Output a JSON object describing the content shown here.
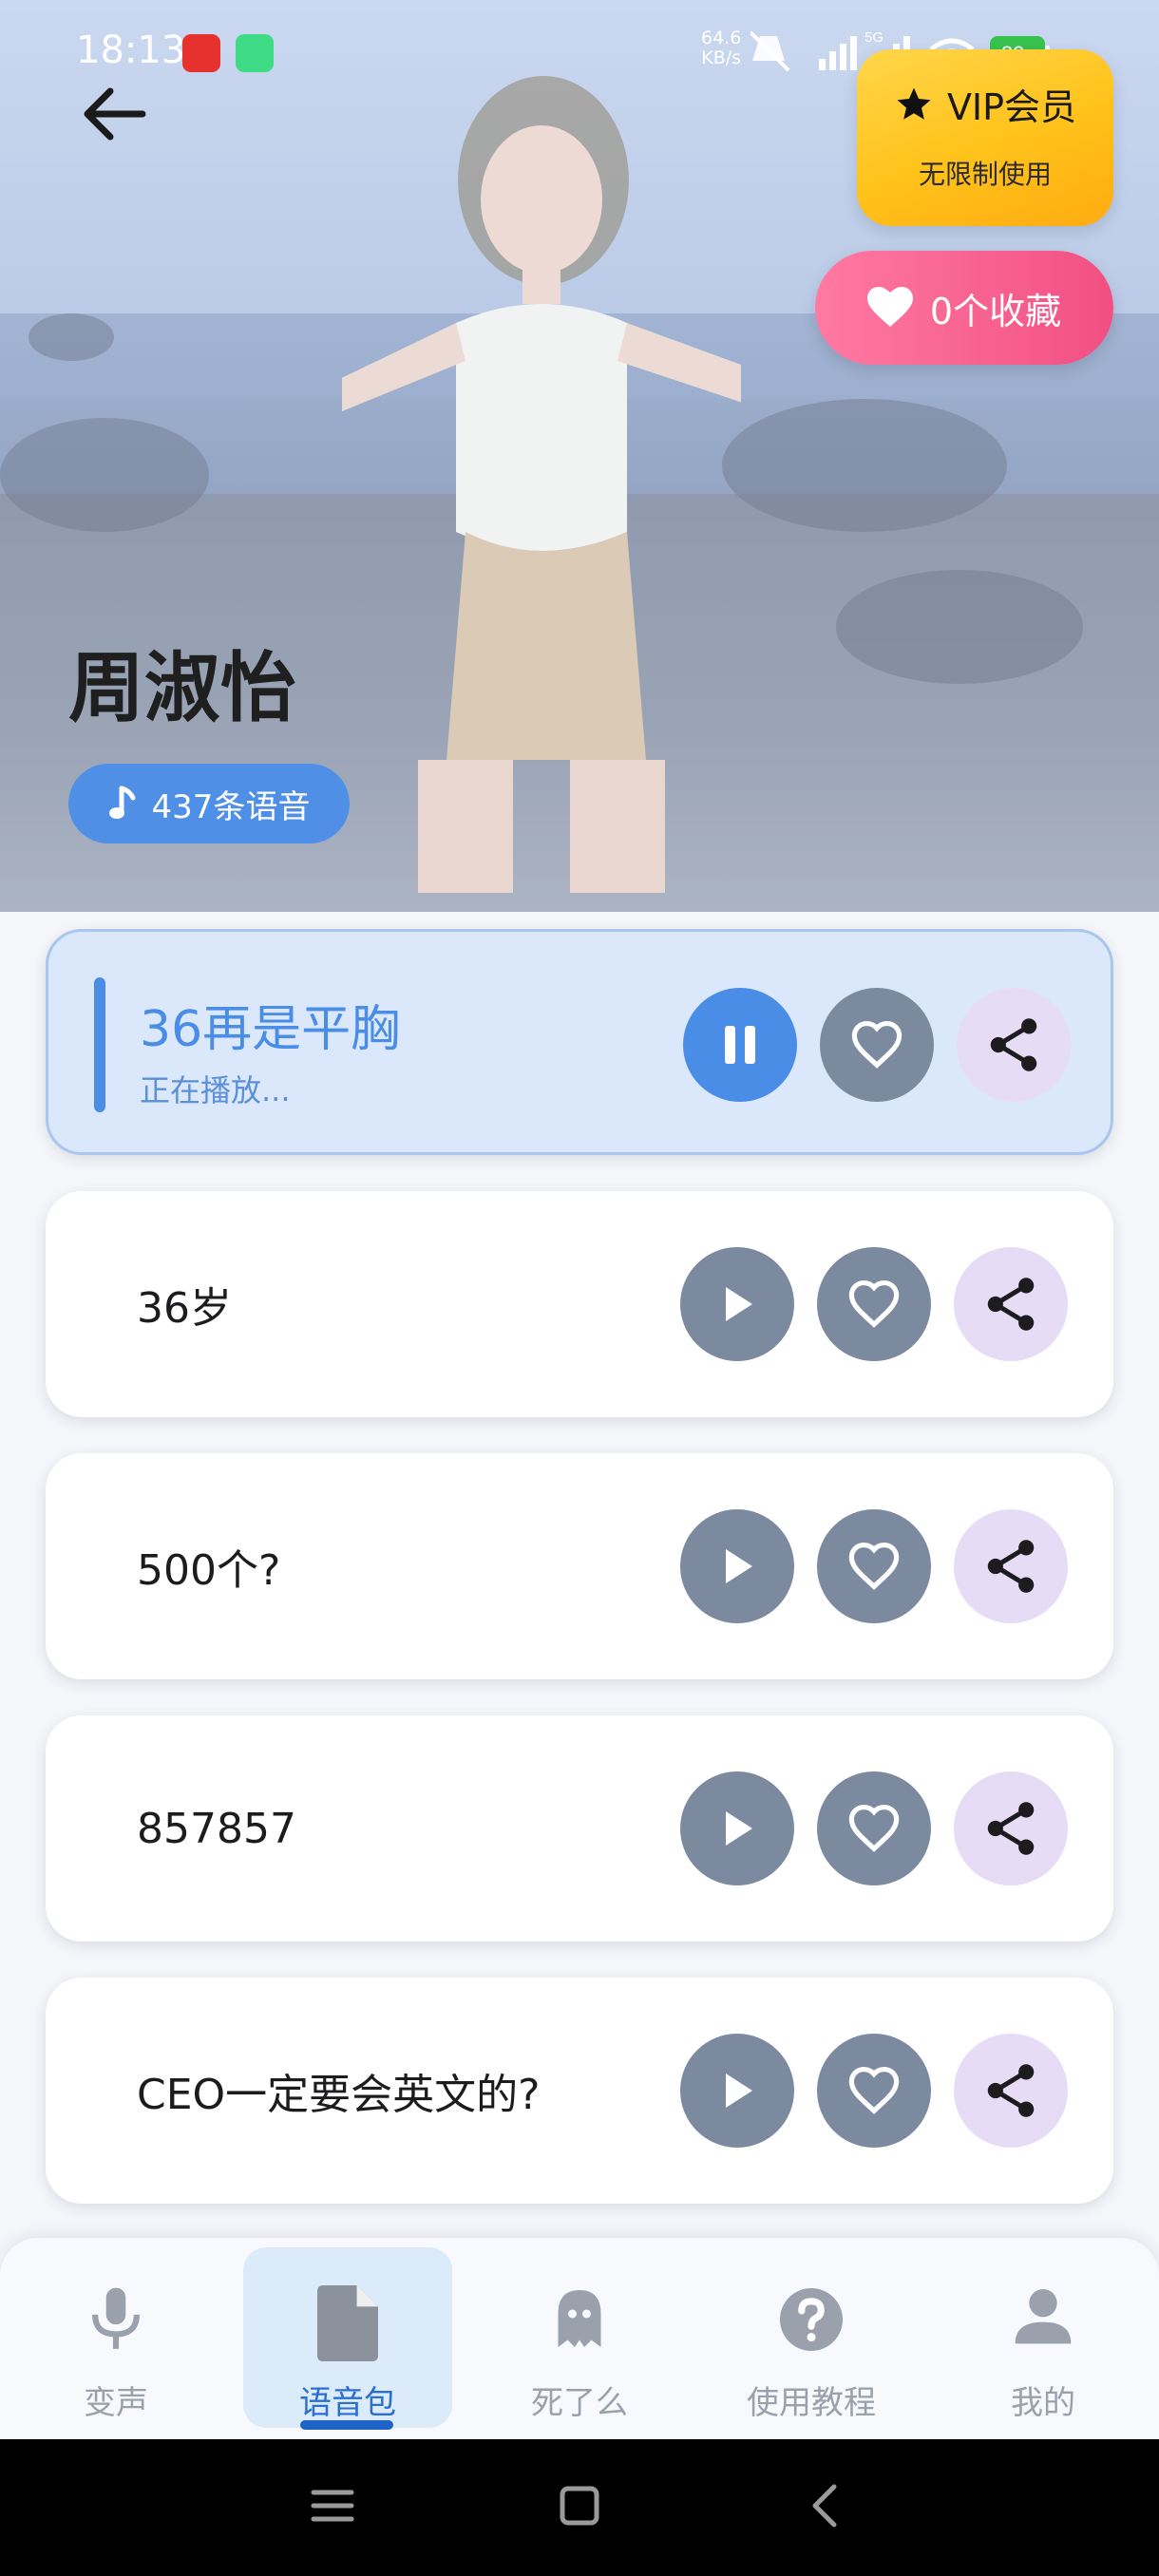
{
  "status_bar": {
    "time": "18:13",
    "net_speed_value": "64.6",
    "net_speed_unit": "KB/s",
    "battery": "39",
    "network": "5G"
  },
  "hero": {
    "vip_title": "VIP会员",
    "vip_subtitle": "无限制使用",
    "favorites_label": "0个收藏",
    "voice_pack_name": "周淑怡",
    "voice_count_label": "437条语音"
  },
  "clips": [
    {
      "title": "36再是平胸",
      "subtitle": "正在播放...",
      "state": "playing"
    },
    {
      "title": "36岁",
      "state": "idle"
    },
    {
      "title": "500个?",
      "state": "idle"
    },
    {
      "title": "857857",
      "state": "idle"
    },
    {
      "title": "CEO一定要会英文的?",
      "state": "idle"
    }
  ],
  "nav": {
    "items": [
      {
        "label": "变声",
        "icon": "microphone-icon"
      },
      {
        "label": "语音包",
        "icon": "file-icon",
        "active": true
      },
      {
        "label": "死了么",
        "icon": "ghost-icon"
      },
      {
        "label": "使用教程",
        "icon": "help-icon"
      },
      {
        "label": "我的",
        "icon": "person-icon"
      }
    ]
  },
  "colors": {
    "accent": "#4a8de6",
    "vip": "#ffc21a",
    "favorite": "#f24f83",
    "button_grey": "#7c8aa0",
    "share_bg": "#e7dcf6"
  }
}
